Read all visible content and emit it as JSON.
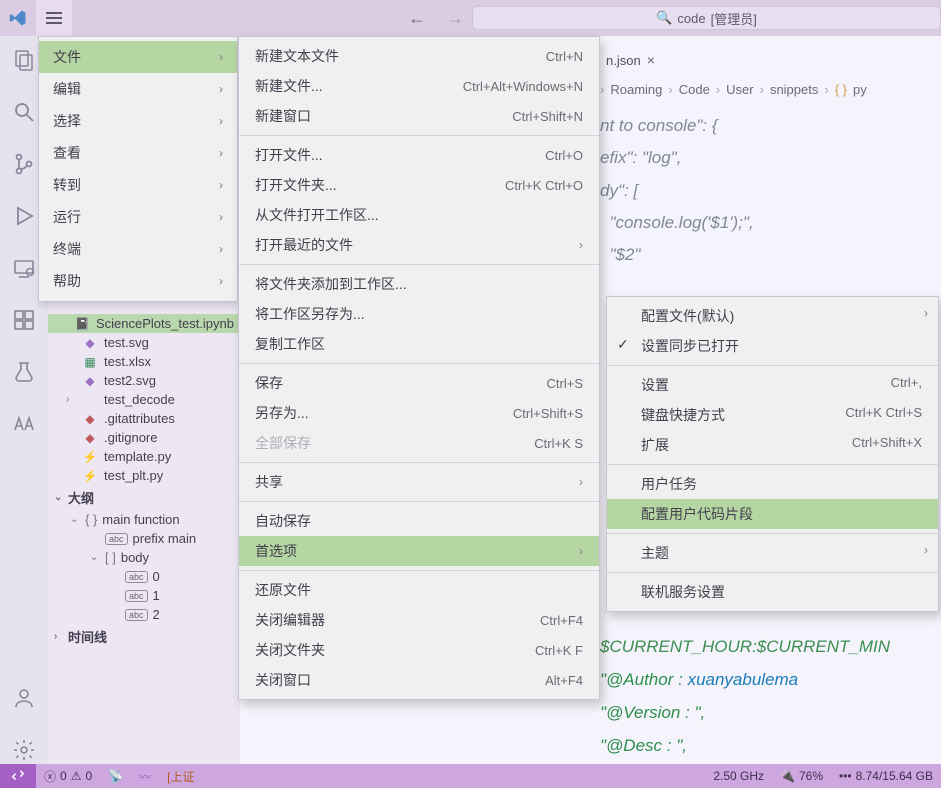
{
  "titlebar": {
    "search_prefix": "code",
    "search_suffix": "[管理员]"
  },
  "menubar": [
    {
      "label": "文件",
      "active": true,
      "submenu_arrow": true
    },
    {
      "label": "编辑",
      "submenu_arrow": true
    },
    {
      "label": "选择",
      "submenu_arrow": true
    },
    {
      "label": "查看",
      "submenu_arrow": true
    },
    {
      "label": "转到",
      "submenu_arrow": true
    },
    {
      "label": "运行",
      "submenu_arrow": true
    },
    {
      "label": "终端",
      "submenu_arrow": true
    },
    {
      "label": "帮助",
      "submenu_arrow": true
    }
  ],
  "file_menu": [
    {
      "label": "新建文本文件",
      "key": "Ctrl+N"
    },
    {
      "label": "新建文件...",
      "key": "Ctrl+Alt+Windows+N"
    },
    {
      "label": "新建窗口",
      "key": "Ctrl+Shift+N"
    },
    {
      "sep": true
    },
    {
      "label": "打开文件...",
      "key": "Ctrl+O"
    },
    {
      "label": "打开文件夹...",
      "key": "Ctrl+K Ctrl+O"
    },
    {
      "label": "从文件打开工作区..."
    },
    {
      "label": "打开最近的文件",
      "arrow": true
    },
    {
      "sep": true
    },
    {
      "label": "将文件夹添加到工作区..."
    },
    {
      "label": "将工作区另存为..."
    },
    {
      "label": "复制工作区"
    },
    {
      "sep": true
    },
    {
      "label": "保存",
      "key": "Ctrl+S"
    },
    {
      "label": "另存为...",
      "key": "Ctrl+Shift+S"
    },
    {
      "label": "全部保存",
      "key": "Ctrl+K S",
      "disabled": true
    },
    {
      "sep": true
    },
    {
      "label": "共享",
      "arrow": true
    },
    {
      "sep": true
    },
    {
      "label": "自动保存"
    },
    {
      "label": "首选项",
      "arrow": true,
      "active": true
    },
    {
      "sep": true
    },
    {
      "label": "还原文件"
    },
    {
      "label": "关闭编辑器",
      "key": "Ctrl+F4"
    },
    {
      "label": "关闭文件夹",
      "key": "Ctrl+K F"
    },
    {
      "label": "关闭窗口",
      "key": "Alt+F4"
    }
  ],
  "pref_menu": [
    {
      "label": "配置文件(默认)",
      "arrow": true
    },
    {
      "label": "设置同步已打开",
      "check": true
    },
    {
      "sep": true
    },
    {
      "label": "设置",
      "key": "Ctrl+,"
    },
    {
      "label": "键盘快捷方式",
      "key": "Ctrl+K Ctrl+S"
    },
    {
      "label": "扩展",
      "key": "Ctrl+Shift+X"
    },
    {
      "sep": true
    },
    {
      "label": "用户任务"
    },
    {
      "label": "配置用户代码片段",
      "active": true
    },
    {
      "sep": true
    },
    {
      "label": "主题",
      "arrow": true
    },
    {
      "sep": true
    },
    {
      "label": "联机服务设置"
    }
  ],
  "explorer": {
    "files": [
      {
        "name": "SciencePlots_test.ipynb",
        "icon": "📓",
        "cls": "col-ipynb",
        "selected": true,
        "chev": ""
      },
      {
        "name": "test.svg",
        "icon": "◆",
        "cls": "col-svg"
      },
      {
        "name": "test.xlsx",
        "icon": "▦",
        "cls": "col-xl"
      },
      {
        "name": "test2.svg",
        "icon": "◆",
        "cls": "col-svg"
      },
      {
        "name": "test_decode",
        "chev": "›",
        "folder": true
      },
      {
        "name": ".gitattributes",
        "icon": "◆",
        "cls": "col-git"
      },
      {
        "name": ".gitignore",
        "icon": "◆",
        "cls": "col-git"
      },
      {
        "name": "template.py",
        "icon": "⚡",
        "cls": "col-py"
      },
      {
        "name": "test_plt.py",
        "icon": "⚡",
        "cls": "col-py"
      }
    ],
    "outline_header": "大纲",
    "outline": [
      {
        "chev": "⌄",
        "icon": "{ }",
        "label": "main function"
      },
      {
        "indent": 1,
        "icon": "abc",
        "label": "prefix  main"
      },
      {
        "indent": 1,
        "chev": "⌄",
        "icon": "[  ]",
        "label": "body"
      },
      {
        "indent": 2,
        "icon": "abc",
        "label": "0"
      },
      {
        "indent": 2,
        "icon": "abc",
        "label": "1"
      },
      {
        "indent": 2,
        "icon": "abc",
        "label": "2"
      }
    ],
    "timeline": "时间线"
  },
  "editor": {
    "tab": "n.json",
    "breadcrumbs": [
      "Roaming",
      "Code",
      "User",
      "snippets",
      "py"
    ],
    "code_top": [
      "nt to console\": {",
      "efix\": \"log\",",
      "dy\": [",
      "  \"console.log('$1');\",",
      "  \"$2\""
    ],
    "code_bot": [
      {
        "v": "$CURRENT_HOUR",
        "s": ":",
        "v2": "$CURRENT_MIN"
      },
      {
        "q": "\"@Author   :   ",
        "val": "xuanyabulema"
      },
      {
        "q": "\"@Version  :   \","
      },
      {
        "q": "\"@Desc     :   \","
      }
    ]
  },
  "status": {
    "errors": "0",
    "warnings": "0",
    "stock": "[上证",
    "cpu": "2.50 GHz",
    "battery": "76%",
    "mem": "8.74/15.64 GB"
  }
}
